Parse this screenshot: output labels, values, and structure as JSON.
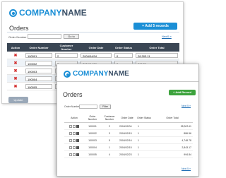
{
  "brand": {
    "part1": "COMPANY",
    "part2": "NAME"
  },
  "colors": {
    "accent": "#1b8fd6",
    "header_dark": "#3a4654",
    "add_green": "#3da33d",
    "delete_red": "#d32f2f"
  },
  "win1": {
    "title": "Orders",
    "add_label": "+ Add 5 records",
    "order_number_label": "Order Number",
    "go_label": "Go to",
    "pager": "Next5 »",
    "columns": [
      "Action",
      "Order Number",
      "Customer Number",
      "Order Date",
      "Order Status",
      "Order Total"
    ],
    "rows": [
      {
        "order": "100001",
        "customer": "2",
        "date": "2004/04/04",
        "status": "0",
        "total": "28,303.11"
      },
      {
        "order": "100002",
        "customer": "3",
        "date": "2004/04/19",
        "status": "0",
        "total": "886.56"
      },
      {
        "order": "100003",
        "customer": "",
        "date": "",
        "status": "",
        "total": ""
      },
      {
        "order": "100004",
        "customer": "",
        "date": "",
        "status": "",
        "total": ""
      },
      {
        "order": "100005",
        "customer": "",
        "date": "",
        "status": "",
        "total": ""
      }
    ],
    "update_label": "Update"
  },
  "win2": {
    "title": "Orders",
    "add_label": "+ Add Record",
    "order_number_label": "Order Number",
    "filter_label": "Filter",
    "pager_top": "Next 5 »",
    "pager_bottom": "Next 5 »",
    "columns": [
      "Action",
      "Order Number",
      "Customer Number",
      "Order Date",
      "Order Status",
      "Order Total"
    ],
    "rows": [
      {
        "order": "100001",
        "customer": "2",
        "date": "2004/02/04",
        "status": "1",
        "total": "28,303.11"
      },
      {
        "order": "100002",
        "customer": "3",
        "date": "2004/02/15",
        "status": "1",
        "total": "886.56"
      },
      {
        "order": "100003",
        "customer": "5",
        "date": "2004/02/16",
        "status": "1",
        "total": "4,748.78"
      },
      {
        "order": "100004",
        "customer": "1",
        "date": "2004/02/15",
        "status": "1",
        "total": "2,843.17"
      },
      {
        "order": "100005",
        "customer": "4",
        "date": "2004/02/23",
        "status": "1",
        "total": "994.84"
      }
    ]
  }
}
